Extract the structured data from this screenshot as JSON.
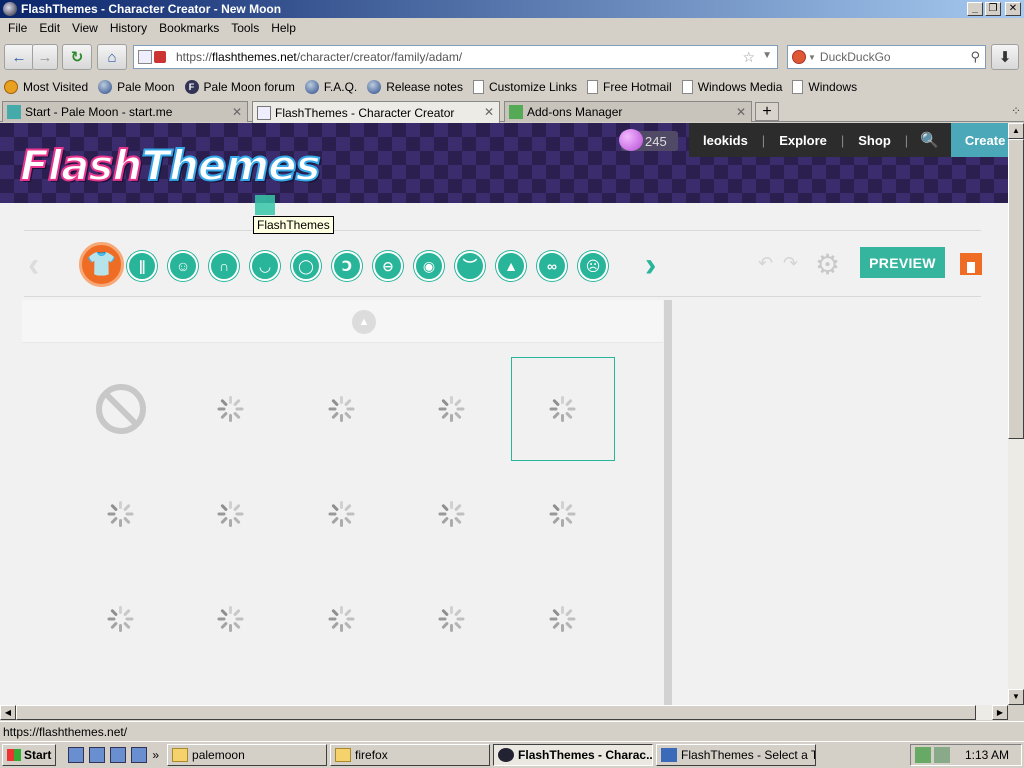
{
  "window": {
    "title": "FlashThemes - Character Creator - New Moon",
    "min_glyph": "_",
    "max_glyph": "❐",
    "close_glyph": "✕"
  },
  "menu": [
    "File",
    "Edit",
    "View",
    "History",
    "Bookmarks",
    "Tools",
    "Help"
  ],
  "nav": {
    "back_glyph": "←",
    "forward_glyph": "→",
    "reload_glyph": "↻",
    "home_glyph": "⌂",
    "url_prefix": "https://",
    "url_host": "flashthemes.net",
    "url_path": "/character/creator/family/adam/",
    "search_placeholder": "DuckDuckGo",
    "download_glyph": "⬇"
  },
  "bookmarks": [
    {
      "label": "Most Visited",
      "icon": "gear-icon"
    },
    {
      "label": "Pale Moon",
      "icon": "globe-icon"
    },
    {
      "label": "Pale Moon forum",
      "icon": "forum-icon"
    },
    {
      "label": "F.A.Q.",
      "icon": "globe-icon"
    },
    {
      "label": "Release notes",
      "icon": "globe-icon"
    },
    {
      "label": "Customize Links",
      "icon": "page-icon"
    },
    {
      "label": "Free Hotmail",
      "icon": "page-icon"
    },
    {
      "label": "Windows Media",
      "icon": "page-icon"
    },
    {
      "label": "Windows",
      "icon": "page-icon"
    }
  ],
  "tabs": [
    {
      "label": "Start - Pale Moon - start.me",
      "active": false
    },
    {
      "label": "FlashThemes - Character Creator",
      "active": true
    },
    {
      "label": "Add-ons Manager",
      "active": false
    }
  ],
  "tabs_list_glyph": "⁘",
  "site": {
    "logo": {
      "part1": "Flash",
      "part2": "Themes"
    },
    "coins": "245",
    "nav": {
      "user": "leokids",
      "explore": "Explore",
      "shop": "Shop",
      "search_glyph": "🔍",
      "create": "Create"
    },
    "tooltip": "FlashThemes",
    "categories": [
      {
        "name": "upper-body",
        "glyph": "👕"
      },
      {
        "name": "lower-body",
        "glyph": "∥"
      },
      {
        "name": "face-shape",
        "glyph": "☺"
      },
      {
        "name": "hair",
        "glyph": "∩"
      },
      {
        "name": "beard",
        "glyph": "◡"
      },
      {
        "name": "mouth",
        "glyph": "◯"
      },
      {
        "name": "ear",
        "glyph": "Ↄ"
      },
      {
        "name": "glasses-face",
        "glyph": "⊖"
      },
      {
        "name": "eye",
        "glyph": "◉"
      },
      {
        "name": "eyebrow",
        "glyph": "︶"
      },
      {
        "name": "nose",
        "glyph": "▲"
      },
      {
        "name": "glasses",
        "glyph": "∞"
      },
      {
        "name": "wrinkles",
        "glyph": "☹"
      }
    ],
    "arrow_left_glyph": "‹",
    "arrow_right_glyph": "›",
    "undo_glyph": "↶",
    "redo_glyph": "↷",
    "settings_glyph": "⚙",
    "preview_label": "PREVIEW",
    "scroll_up_glyph": "▲"
  },
  "status_text": "https://flashthemes.net/",
  "taskbar": {
    "start_label": "Start",
    "quicklaunch_more": "»",
    "buttons": [
      {
        "label": "palemoon",
        "icon": "folder",
        "active": false
      },
      {
        "label": "firefox",
        "icon": "folder",
        "active": false
      },
      {
        "label": "FlashThemes - Charac...",
        "icon": "pm",
        "active": true
      },
      {
        "label": "FlashThemes - Select a T...",
        "icon": "ie",
        "active": false
      }
    ],
    "clock": "1:13 AM"
  }
}
